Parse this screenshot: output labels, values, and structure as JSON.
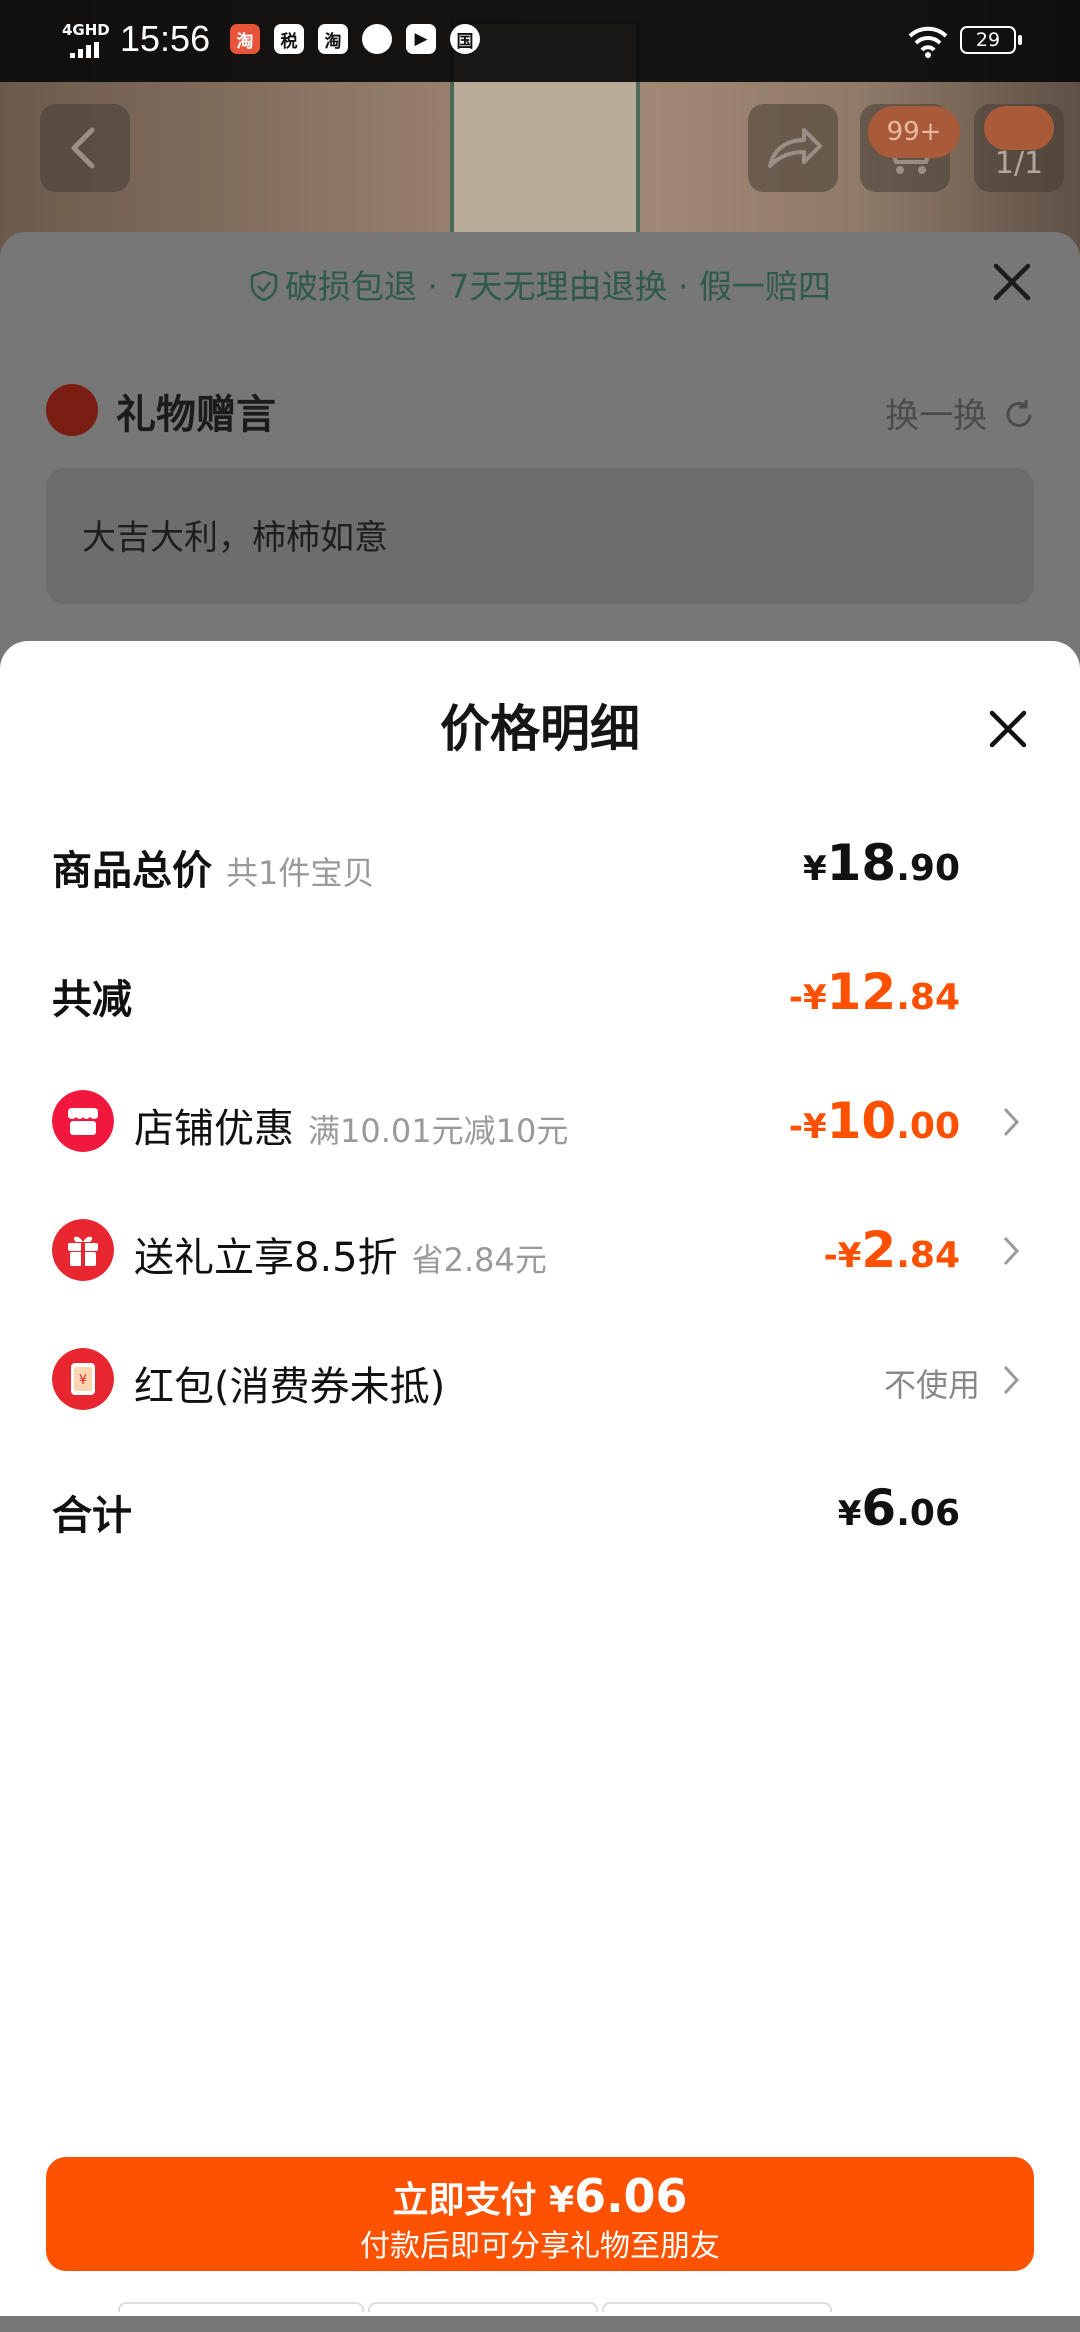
{
  "status_bar": {
    "network": "4GHD",
    "time": "15:56",
    "app_icons": [
      "淘",
      "税",
      "淘",
      "消息",
      "播放",
      "国"
    ],
    "battery": "29"
  },
  "background_page": {
    "nav": {
      "cart_badge": "99+",
      "page_indicator": "1/1"
    },
    "guarantee": "破损包退 · 7天无理由退换 · 假一赔四",
    "gift_message": {
      "title": "礼物赠言",
      "swap_label": "换一换",
      "message": "大吉大利，柿柿如意"
    }
  },
  "price_detail": {
    "title": "价格明细",
    "rows": {
      "total": {
        "label": "商品总价",
        "sub": "共1件宝贝",
        "currency": "¥",
        "int": "18",
        "dec": ".90"
      },
      "discount_total": {
        "label": "共减",
        "currency": "-¥",
        "int": "12",
        "dec": ".84"
      },
      "shop_promo": {
        "label": "店铺优惠",
        "sub": "满10.01元减10元",
        "currency": "-¥",
        "int": "10",
        "dec": ".00"
      },
      "gift_discount": {
        "label": "送礼立享8.5折",
        "sub": "省2.84元",
        "currency": "-¥",
        "int": "2",
        "dec": ".84"
      },
      "red_packet": {
        "label": "红包(消费券未抵)",
        "value": "不使用"
      },
      "sum": {
        "label": "合计",
        "currency": "¥",
        "int": "6",
        "dec": ".06"
      }
    }
  },
  "pay_button": {
    "label": "立即支付",
    "currency": "¥",
    "amount": "6.06",
    "sub": "付款后即可分享礼物至朋友"
  },
  "colors": {
    "accent": "#ff5000",
    "button": "#ff5200",
    "icon_red": "#e8262f"
  }
}
